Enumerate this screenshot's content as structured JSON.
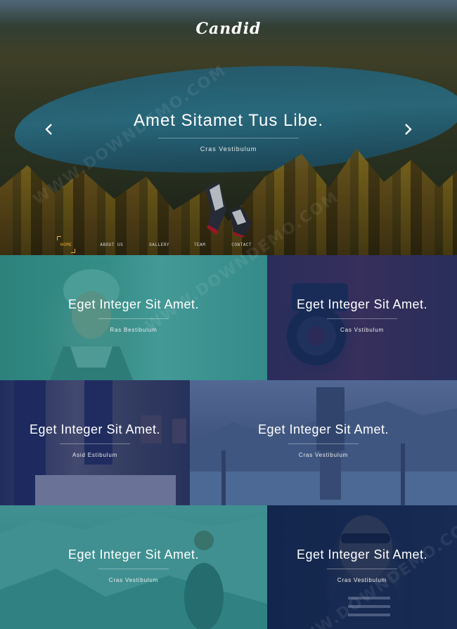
{
  "site": {
    "brand": "Candid"
  },
  "hero": {
    "title": "Amet Sitamet Tus Libe.",
    "subtitle": "Cras Vestibulum",
    "prev_icon": "chevron-left-icon",
    "next_icon": "chevron-right-icon"
  },
  "nav": {
    "items": [
      {
        "label": "HOME",
        "active": true
      },
      {
        "label": "ABOUT US",
        "active": false
      },
      {
        "label": "GALLERY",
        "active": false
      },
      {
        "label": "TEAM",
        "active": false
      },
      {
        "label": "CONTACT",
        "active": false
      }
    ],
    "active_color": "#f2b23a"
  },
  "tiles": [
    {
      "title": "Eget Integer Sit Amet.",
      "subtitle": "Ras Bestibulum",
      "tint": "#2096a0"
    },
    {
      "title": "Eget Integer Sit Amet.",
      "subtitle": "Cas Vstibulum",
      "tint": "#193778"
    },
    {
      "title": "Eget Integer Sit Amet.",
      "subtitle": "Asid Estibulum",
      "tint": "#192d6e"
    },
    {
      "title": "Eget Integer Sit Amet.",
      "subtitle": "Cras Vestibulum",
      "tint": "#325096"
    },
    {
      "title": "Eget Integer Sit Amet.",
      "subtitle": "Cras Vestibulum",
      "tint": "#1e9696"
    },
    {
      "title": "Eget Integer Sit Amet.",
      "subtitle": "Cras Vestibulum",
      "tint": "#0f285a"
    }
  ],
  "watermark": "WWW.DOWNDEMO.COM"
}
